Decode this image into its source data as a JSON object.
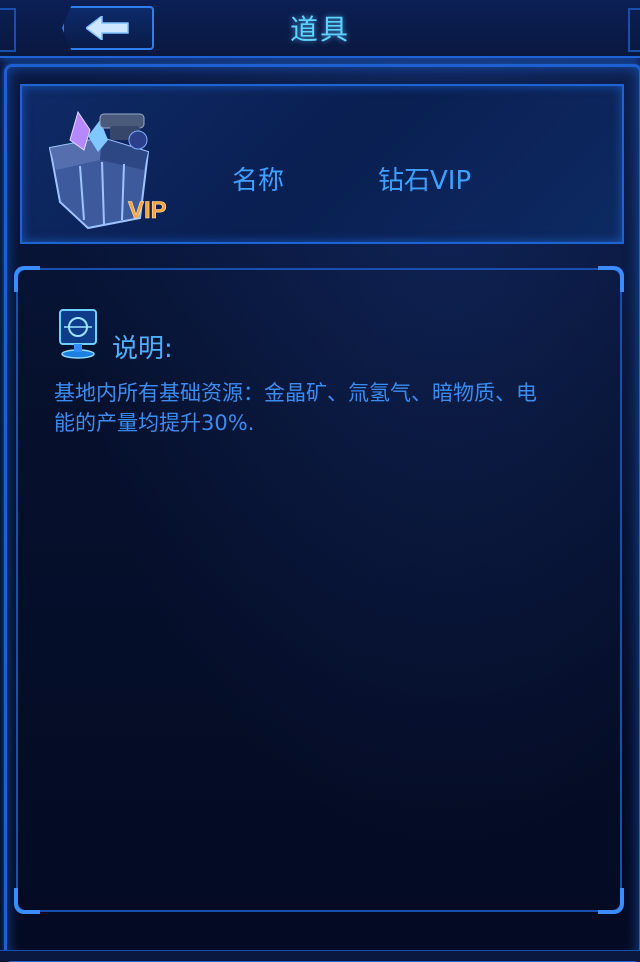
{
  "header": {
    "title": "道具",
    "back_icon": "back-arrow-icon"
  },
  "item": {
    "name_label": "名称",
    "name_value": "钻石VIP",
    "badge_text": "VIP",
    "image_icon": "vip-treasure-chest-icon"
  },
  "description": {
    "title": "说明:",
    "icon": "hologram-info-icon",
    "text": "基地内所有基础资源：金晶矿、氚氢气、暗物质、电能的产量均提升30%."
  },
  "colors": {
    "accent": "#1f64d4",
    "text_blue": "#3fa0ff",
    "title_cyan": "#5fd2ff",
    "badge_orange": "#f7a23a"
  }
}
